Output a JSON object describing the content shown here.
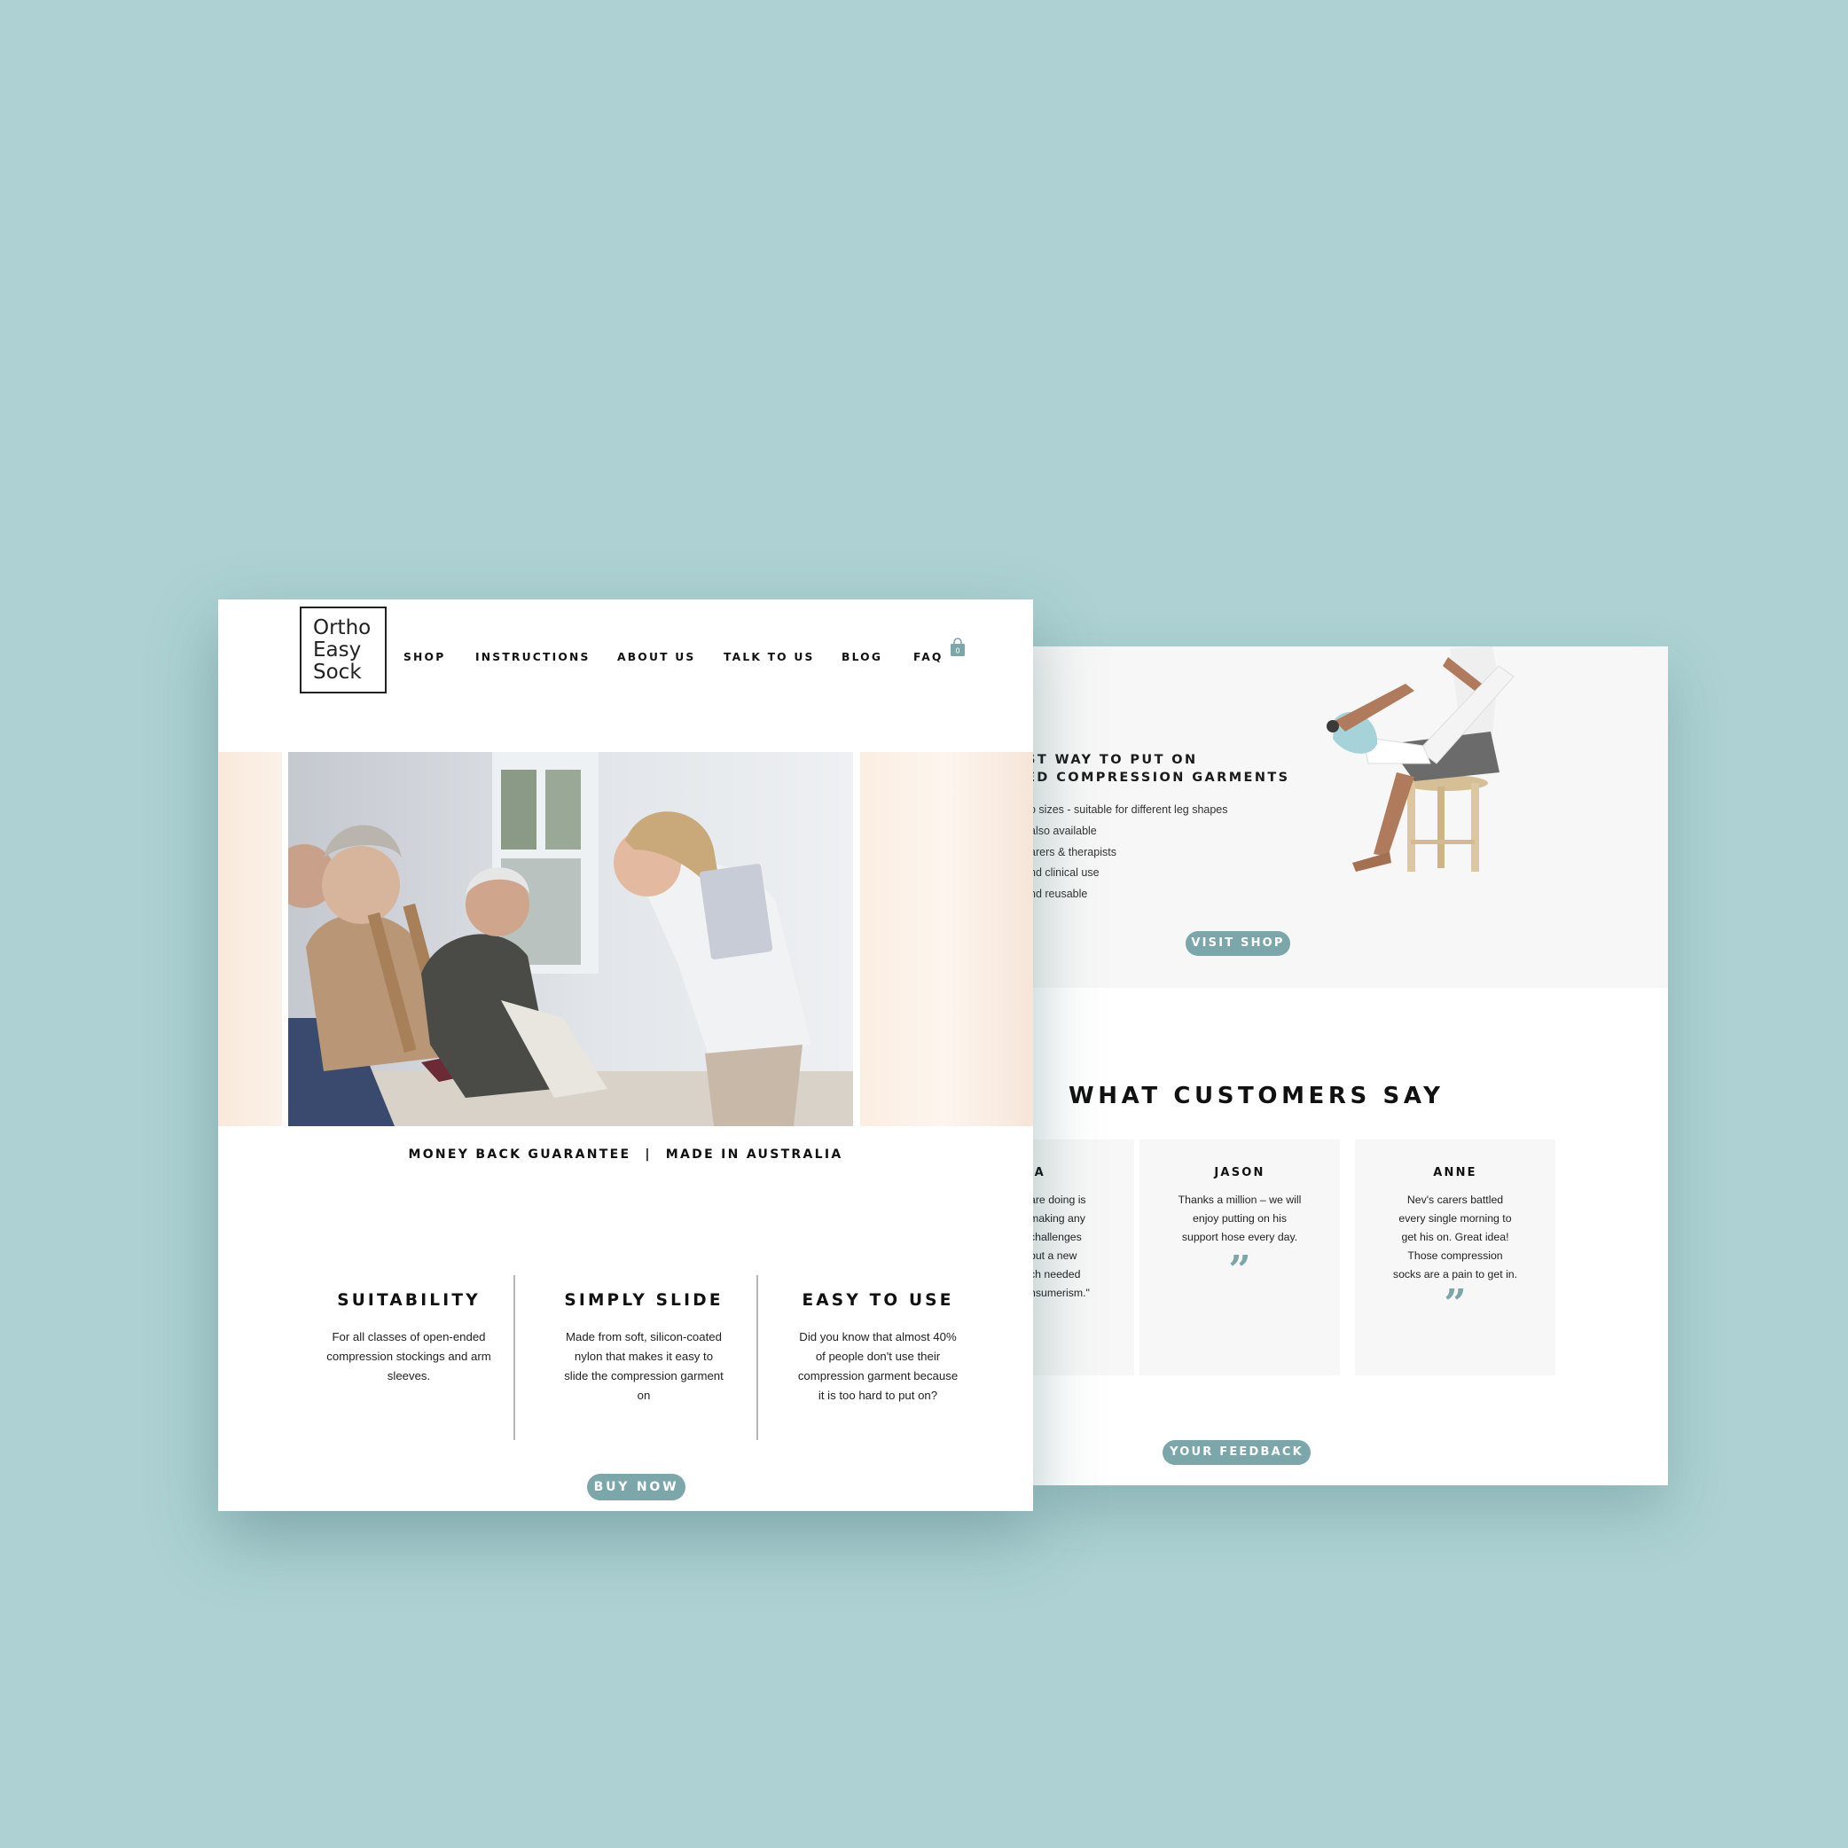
{
  "back": {
    "hero_heading_1": "ST WAY TO PUT ON",
    "hero_heading_2": "ED COMPRESSION GARMENTS",
    "bullets": [
      "o sizes - suitable for different leg shapes",
      "also available",
      "arers & therapists",
      "nd clinical use",
      "nd reusable"
    ],
    "visit_shop_label": "VISIT SHOP",
    "customers_title": "WHAT CUSTOMERS SAY",
    "testimonials": [
      {
        "name": "SA",
        "lines": [
          "are doing is",
          "making any",
          "challenges",
          "but a new",
          "ch needed",
          "nsumerism.\""
        ]
      },
      {
        "name": "JASON",
        "lines": [
          "Thanks a million – we will",
          "enjoy putting on his",
          "support hose every day."
        ]
      },
      {
        "name": "ANNE",
        "lines": [
          "Nev's carers battled",
          "every single morning to",
          "get his on. Great idea!",
          "Those compression",
          "socks are a pain to get in."
        ]
      }
    ],
    "quote_mark": "”",
    "feedback_label": "YOUR FEEDBACK"
  },
  "front": {
    "logo": {
      "line1": "Ortho",
      "line2": "Easy",
      "line3": "Sock"
    },
    "nav": [
      "SHOP",
      "INSTRUCTIONS",
      "ABOUT US",
      "TALK TO US",
      "BLOG",
      "FAQ"
    ],
    "cart_count": "0",
    "guarantee": "MONEY BACK GUARANTEE",
    "separator": "|",
    "made_in": "MADE IN AUSTRALIA",
    "features": [
      {
        "title": "SUITABILITY",
        "text": "For all classes of open-ended compression stockings and arm sleeves."
      },
      {
        "title": "SIMPLY SLIDE",
        "text": "Made from soft, silicon-coated nylon that makes it easy to slide the compression garment on"
      },
      {
        "title": "EASY TO USE",
        "text": "Did you know that almost 40% of people don't use their compression garment because it is too hard to put on?"
      }
    ],
    "buy_now_label": "BUY NOW"
  },
  "colors": {
    "background": "#aed2d3",
    "accent": "#7ca7aa",
    "card_bg": "#f7f7f7"
  }
}
